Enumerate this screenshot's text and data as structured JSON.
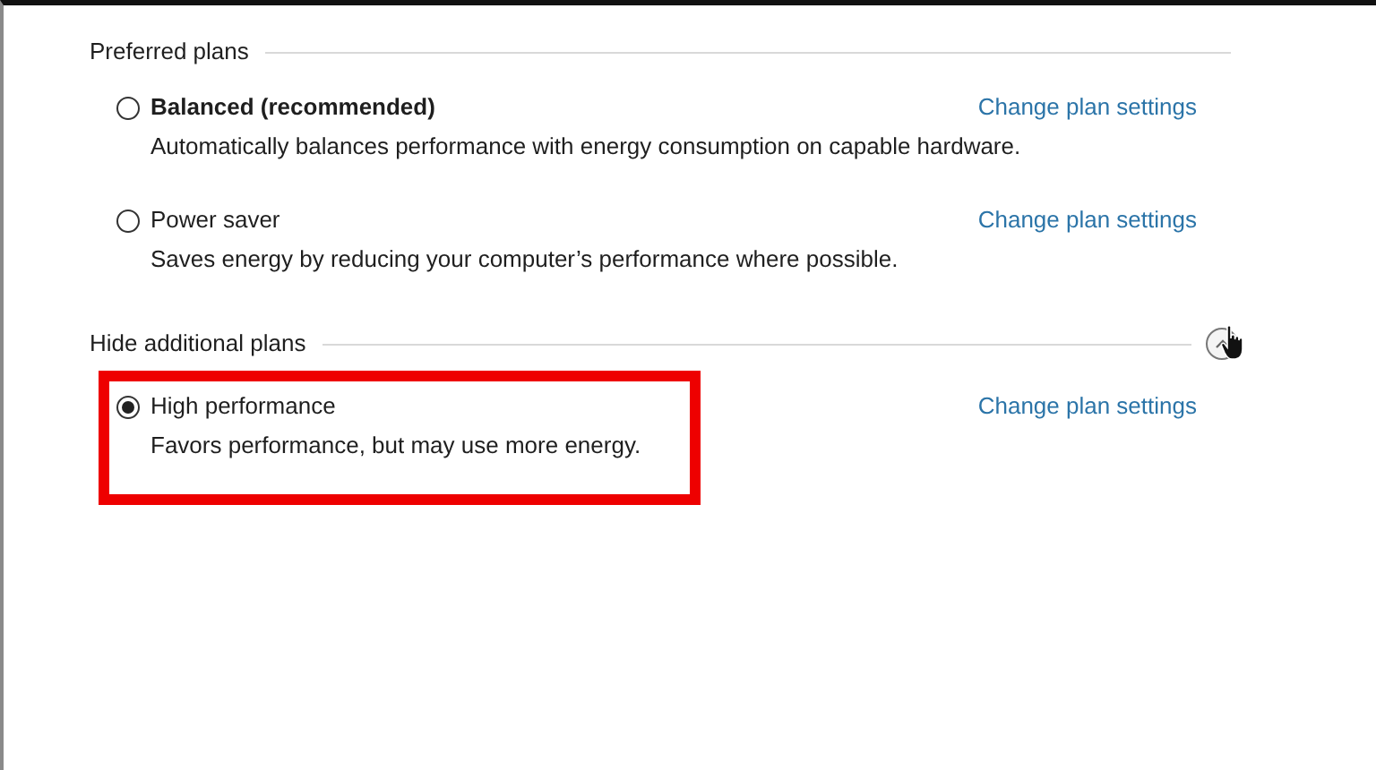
{
  "sections": [
    {
      "title": "Preferred plans",
      "plans": [
        {
          "name": "Balanced (recommended)",
          "recommended": true,
          "description": "Automatically balances performance with energy consumption on capable hardware.",
          "selected": false,
          "highlighted": false,
          "link": "Change plan settings"
        },
        {
          "name": "Power saver",
          "recommended": false,
          "description": "Saves energy by reducing your computer’s performance where possible.",
          "selected": false,
          "highlighted": false,
          "link": "Change plan settings"
        }
      ]
    },
    {
      "title": "Hide additional plans",
      "collapse_button": {
        "expanded": true,
        "hovered": true
      },
      "plans": [
        {
          "name": "High performance",
          "recommended": false,
          "description": "Favors performance, but may use more energy.",
          "selected": true,
          "highlighted": true,
          "link": "Change plan settings"
        }
      ]
    }
  ]
}
